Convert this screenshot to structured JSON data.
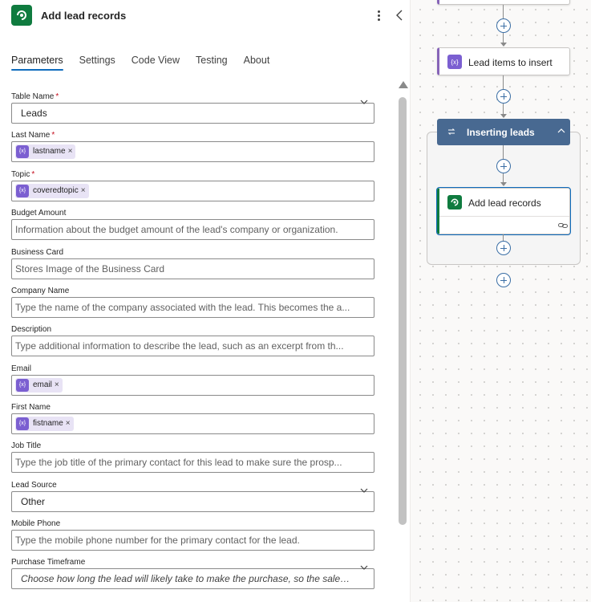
{
  "panel": {
    "title": "Add lead records",
    "tabs": [
      {
        "label": "Parameters",
        "active": true
      },
      {
        "label": "Settings",
        "active": false
      },
      {
        "label": "Code View",
        "active": false
      },
      {
        "label": "Testing",
        "active": false
      },
      {
        "label": "About",
        "active": false
      }
    ]
  },
  "fields": {
    "table_name": {
      "label": "Table Name",
      "required": "*",
      "value": "Leads"
    },
    "last_name": {
      "label": "Last Name",
      "required": "*",
      "token": "lastname"
    },
    "topic": {
      "label": "Topic",
      "required": "*",
      "token": "coveredtopic"
    },
    "budget_amount": {
      "label": "Budget Amount",
      "placeholder": "Information about the budget amount of the lead's company or organization."
    },
    "business_card": {
      "label": "Business Card",
      "placeholder": "Stores Image of the Business Card"
    },
    "company_name": {
      "label": "Company Name",
      "placeholder": "Type the name of the company associated with the lead. This becomes the a..."
    },
    "description": {
      "label": "Description",
      "placeholder": "Type additional information to describe the lead, such as an excerpt from th..."
    },
    "email": {
      "label": "Email",
      "token": "email"
    },
    "first_name": {
      "label": "First Name",
      "token": "fistname"
    },
    "job_title": {
      "label": "Job Title",
      "placeholder": "Type the job title of the primary contact for this lead to make sure the prosp..."
    },
    "lead_source": {
      "label": "Lead Source",
      "value": "Other"
    },
    "mobile_phone": {
      "label": "Mobile Phone",
      "placeholder": "Type the mobile phone number for the primary contact for the lead."
    },
    "purchase_timeframe": {
      "label": "Purchase Timeframe",
      "placeholder": "Choose how long the lead will likely take to make the purchase, so the sales tea..."
    }
  },
  "token_icon_text": "{x}",
  "token_close": "×",
  "canvas": {
    "lead_items_label": "Lead items to insert",
    "scope_label": "Inserting leads",
    "add_records_label": "Add lead records"
  },
  "colors": {
    "accent": "#0f6cbd",
    "dataverse_green": "#0f7b3f",
    "variable_purple": "#7b5fd1",
    "scope_blue": "#486991",
    "required_red": "#c50f1f"
  }
}
